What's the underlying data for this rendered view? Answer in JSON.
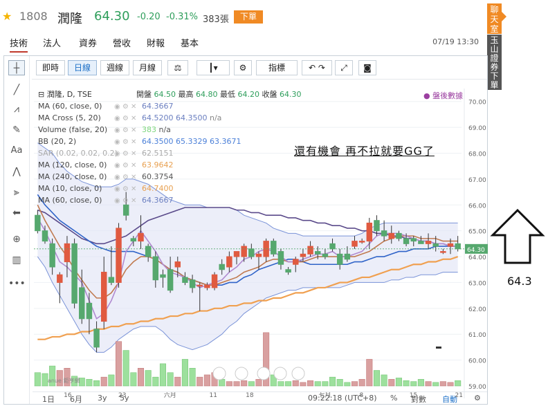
{
  "header": {
    "code": "1808",
    "name": "潤隆",
    "price": "64.30",
    "change": "-0.20",
    "change_pct": "-0.31%",
    "volume": "383張",
    "order_button": "下單"
  },
  "tabs": [
    {
      "label": "技術",
      "active": true
    },
    {
      "label": "法人",
      "active": false
    },
    {
      "label": "資券",
      "active": false
    },
    {
      "label": "營收",
      "active": false
    },
    {
      "label": "財報",
      "active": false
    },
    {
      "label": "基本",
      "active": false
    }
  ],
  "datetime": "07/19 13:30",
  "side": {
    "chatroom": "聊天室",
    "esun": "玉山證券下單"
  },
  "toolbar": {
    "periods": [
      "即時",
      "日線",
      "週線",
      "月線"
    ],
    "selected_period": "日線",
    "indicators_label": "指標"
  },
  "legend": {
    "title": "潤隆, D, TSE",
    "ohlc": {
      "open_label": "開盤",
      "open": "64.50",
      "high_label": "最高",
      "high": "64.80",
      "low_label": "最低",
      "low": "64.20",
      "close_label": "收盤",
      "close": "64.30"
    },
    "after_hours": "盤後數據",
    "studies": [
      {
        "name": "MA (60, close, 0)",
        "values": [
          "64.3667"
        ],
        "colors": [
          "#6b7fc0"
        ]
      },
      {
        "name": "MA Cross (5, 20)",
        "values": [
          "64.5200",
          "64.3500",
          "n/a"
        ],
        "colors": [
          "#6b7fc0",
          "#6b7fc0",
          "#888888"
        ]
      },
      {
        "name": "Volume (false, 20)",
        "values": [
          "383",
          "n/a"
        ],
        "colors": [
          "#7cd67c",
          "#555555"
        ]
      },
      {
        "name": "BB (20, 2)",
        "values": [
          "64.3500",
          "65.3329",
          "63.3671"
        ],
        "colors": [
          "#4a7fd8",
          "#4a7fd8",
          "#4a7fd8"
        ]
      },
      {
        "name": "SAR (0.02, 0.02, 0.2)",
        "values": [
          "62.5151"
        ],
        "colors": [
          "#aaaaaa"
        ]
      },
      {
        "name": "MA (120, close, 0)",
        "values": [
          "63.9642"
        ],
        "colors": [
          "#e8a050"
        ]
      },
      {
        "name": "MA (240, close, 0)",
        "values": [
          "60.3754"
        ],
        "colors": [
          "#555555"
        ]
      },
      {
        "name": "MA (10, close, 0)",
        "values": [
          "64.7400"
        ],
        "colors": [
          "#e8a050"
        ]
      },
      {
        "name": "MA (60, close, 0)",
        "values": [
          "64.3667"
        ],
        "colors": [
          "#6b7fc0"
        ]
      }
    ]
  },
  "price_axis": {
    "ticks": [
      "70.00",
      "69.00",
      "68.00",
      "67.00",
      "66.00",
      "65.00",
      "64.00",
      "63.00",
      "62.00",
      "61.00",
      "60.00",
      "59.00"
    ],
    "current": "64.30"
  },
  "date_axis": [
    "16",
    "23",
    "六月",
    "11",
    "18",
    "七月",
    "8",
    "15",
    "21"
  ],
  "bottombar": {
    "ranges": [
      "1日",
      "6月",
      "3y",
      "5y"
    ],
    "time": "09:22:18 (UTC+8)",
    "pct": "%",
    "log": "對數",
    "auto": "自動"
  },
  "annotation": {
    "text": "還有機會 再不拉就要GG了",
    "arrow_value": "64.3"
  },
  "watermark": "anue 鉅亨網",
  "colors": {
    "up": "#e05a40",
    "down": "#56a86e",
    "accent": "#f08a24"
  },
  "chart_data": {
    "type": "candlestick",
    "ylim": [
      59,
      70.5
    ],
    "candles": [
      {
        "o": 65.6,
        "h": 65.8,
        "l": 64.9,
        "c": 65.0
      },
      {
        "o": 65.0,
        "h": 65.2,
        "l": 64.5,
        "c": 64.6
      },
      {
        "o": 64.5,
        "h": 64.7,
        "l": 63.3,
        "c": 63.6
      },
      {
        "o": 63.0,
        "h": 63.4,
        "l": 62.2,
        "c": 63.3
      },
      {
        "o": 63.8,
        "h": 64.8,
        "l": 63.2,
        "c": 64.5
      },
      {
        "o": 64.5,
        "h": 64.7,
        "l": 62.0,
        "c": 62.2
      },
      {
        "o": 62.8,
        "h": 63.5,
        "l": 61.4,
        "c": 61.6
      },
      {
        "o": 62.2,
        "h": 62.6,
        "l": 61.0,
        "c": 61.6
      },
      {
        "o": 61.2,
        "h": 61.5,
        "l": 60.3,
        "c": 60.5
      },
      {
        "o": 61.5,
        "h": 64.0,
        "l": 61.2,
        "c": 63.4
      },
      {
        "o": 63.2,
        "h": 64.4,
        "l": 62.9,
        "c": 63.0
      },
      {
        "o": 63.0,
        "h": 65.3,
        "l": 62.8,
        "c": 65.1
      },
      {
        "o": 66.0,
        "h": 66.5,
        "l": 65.4,
        "c": 65.6
      },
      {
        "o": 64.7,
        "h": 64.8,
        "l": 64.4,
        "c": 64.6
      },
      {
        "o": 64.6,
        "h": 65.6,
        "l": 64.3,
        "c": 64.9
      },
      {
        "o": 64.4,
        "h": 64.5,
        "l": 63.8,
        "c": 64.0
      },
      {
        "o": 64.0,
        "h": 64.2,
        "l": 62.8,
        "c": 63.1
      },
      {
        "o": 63.3,
        "h": 63.5,
        "l": 62.8,
        "c": 63.2
      },
      {
        "o": 63.5,
        "h": 64.0,
        "l": 62.6,
        "c": 62.7
      },
      {
        "o": 63.6,
        "h": 64.0,
        "l": 63.2,
        "c": 63.8
      },
      {
        "o": 63.2,
        "h": 63.4,
        "l": 62.9,
        "c": 63.0
      },
      {
        "o": 63.1,
        "h": 63.3,
        "l": 62.6,
        "c": 62.8
      },
      {
        "o": 62.9,
        "h": 63.0,
        "l": 61.9,
        "c": 62.9
      },
      {
        "o": 62.8,
        "h": 63.0,
        "l": 62.7,
        "c": 62.9
      },
      {
        "o": 62.8,
        "h": 63.4,
        "l": 62.7,
        "c": 63.3
      },
      {
        "o": 63.7,
        "h": 63.9,
        "l": 63.3,
        "c": 63.5
      },
      {
        "o": 63.6,
        "h": 64.2,
        "l": 63.4,
        "c": 64.0
      },
      {
        "o": 64.0,
        "h": 64.2,
        "l": 63.7,
        "c": 64.2
      },
      {
        "o": 64.0,
        "h": 64.5,
        "l": 63.8,
        "c": 64.4
      },
      {
        "o": 64.3,
        "h": 64.5,
        "l": 63.9,
        "c": 64.0
      },
      {
        "o": 64.0,
        "h": 64.2,
        "l": 63.5,
        "c": 64.1
      },
      {
        "o": 64.0,
        "h": 64.7,
        "l": 63.8,
        "c": 64.6
      },
      {
        "o": 64.6,
        "h": 64.7,
        "l": 64.0,
        "c": 64.1
      },
      {
        "o": 64.2,
        "h": 64.3,
        "l": 63.5,
        "c": 63.7
      },
      {
        "o": 63.5,
        "h": 63.6,
        "l": 63.3,
        "c": 63.4
      },
      {
        "o": 63.7,
        "h": 64.0,
        "l": 63.4,
        "c": 63.9
      },
      {
        "o": 64.0,
        "h": 64.3,
        "l": 63.8,
        "c": 64.1
      },
      {
        "o": 64.1,
        "h": 64.6,
        "l": 64.0,
        "c": 64.4
      },
      {
        "o": 64.2,
        "h": 64.4,
        "l": 63.9,
        "c": 64.1
      },
      {
        "o": 64.1,
        "h": 64.3,
        "l": 63.9,
        "c": 64.0
      },
      {
        "o": 64.5,
        "h": 64.7,
        "l": 64.2,
        "c": 64.3
      },
      {
        "o": 64.1,
        "h": 64.3,
        "l": 63.5,
        "c": 63.7
      },
      {
        "o": 64.1,
        "h": 64.4,
        "l": 63.8,
        "c": 63.9
      },
      {
        "o": 64.4,
        "h": 64.8,
        "l": 64.3,
        "c": 64.6
      },
      {
        "o": 64.6,
        "h": 64.7,
        "l": 64.5,
        "c": 64.6
      },
      {
        "o": 64.6,
        "h": 65.5,
        "l": 64.3,
        "c": 65.3
      },
      {
        "o": 65.4,
        "h": 65.6,
        "l": 64.8,
        "c": 65.0
      },
      {
        "o": 65.0,
        "h": 65.4,
        "l": 64.6,
        "c": 64.8
      },
      {
        "o": 64.7,
        "h": 65.2,
        "l": 64.5,
        "c": 64.9
      },
      {
        "o": 64.9,
        "h": 65.0,
        "l": 64.6,
        "c": 64.7
      },
      {
        "o": 64.7,
        "h": 64.9,
        "l": 64.4,
        "c": 64.5
      },
      {
        "o": 64.7,
        "h": 64.8,
        "l": 64.4,
        "c": 64.6
      },
      {
        "o": 64.6,
        "h": 64.8,
        "l": 64.5,
        "c": 64.5
      },
      {
        "o": 64.5,
        "h": 64.9,
        "l": 64.3,
        "c": 64.6
      },
      {
        "o": 64.5,
        "h": 64.8,
        "l": 64.2,
        "c": 64.4
      },
      {
        "o": 64.2,
        "h": 64.3,
        "l": 64.1,
        "c": 64.2
      },
      {
        "o": 64.4,
        "h": 64.7,
        "l": 64.1,
        "c": 64.5
      },
      {
        "o": 64.5,
        "h": 64.8,
        "l": 64.2,
        "c": 64.3
      }
    ],
    "volume": [
      0.3,
      0.28,
      0.45,
      0.35,
      0.4,
      0.22,
      0.18,
      0.15,
      0.12,
      0.2,
      0.25,
      1.0,
      0.8,
      0.3,
      0.4,
      0.35,
      0.2,
      0.5,
      0.3,
      0.2,
      0.6,
      0.4,
      0.2,
      0.25,
      0.3,
      0.15,
      0.1,
      0.1,
      0.12,
      0.1,
      0.15,
      1.2,
      0.25,
      0.1,
      0.1,
      0.12,
      0.08,
      0.12,
      0.1,
      0.1,
      0.2,
      0.15,
      0.08,
      0.1,
      0.15,
      0.6,
      0.35,
      0.25,
      0.15,
      0.18,
      0.12,
      0.1,
      0.15,
      0.1,
      0.08,
      0.1,
      0.08,
      0.12
    ],
    "volume_ylim": [
      0,
      1.4
    ],
    "ma_lines": [
      {
        "name": "MA (60, close, 0)",
        "color": "#5a4a8a",
        "values": [
          65.8,
          65.7,
          65.5,
          65.3,
          65.1,
          64.9,
          64.7,
          64.6,
          64.5,
          64.5,
          64.6,
          64.7,
          64.8,
          65.0,
          65.2,
          65.4,
          65.5,
          65.6,
          65.7,
          65.8,
          65.9,
          65.9,
          65.9,
          65.9,
          65.9,
          65.9,
          65.9,
          65.8,
          65.8,
          65.7,
          65.7,
          65.6,
          65.6,
          65.6,
          65.5,
          65.5,
          65.4,
          65.4,
          65.3,
          65.3,
          65.2,
          65.2,
          65.1,
          65.1,
          65.0,
          65.0,
          64.9,
          64.9,
          64.8,
          64.8,
          64.7,
          64.7,
          64.6,
          64.6,
          64.5,
          64.5,
          64.4,
          64.4
        ]
      },
      {
        "name": "MA (20, close, 0)",
        "color": "#2f63c8",
        "values": [
          66.4,
          66.0,
          65.7,
          65.4,
          65.2,
          65.0,
          64.8,
          64.6,
          64.4,
          64.3,
          64.2,
          64.2,
          64.2,
          64.2,
          64.1,
          64.0,
          63.9,
          63.7,
          63.5,
          63.4,
          63.2,
          63.1,
          63.0,
          62.9,
          62.9,
          62.9,
          63.0,
          63.0,
          63.2,
          63.3,
          63.5,
          63.6,
          63.7,
          63.8,
          63.9,
          63.9,
          63.8,
          63.7,
          63.7,
          63.7,
          63.7,
          63.7,
          63.7,
          63.8,
          63.8,
          63.9,
          64.0,
          64.0,
          64.1,
          64.2,
          64.2,
          64.3,
          64.3,
          64.3,
          64.4,
          64.4,
          64.4,
          64.4
        ]
      },
      {
        "name": "MA (120, close, 0)",
        "color": "#f0a050",
        "values": [
          60.8,
          60.8,
          60.9,
          60.9,
          61.0,
          61.0,
          61.1,
          61.1,
          61.2,
          61.2,
          61.3,
          61.3,
          61.4,
          61.4,
          61.5,
          61.5,
          61.6,
          61.6,
          61.7,
          61.7,
          61.8,
          61.8,
          61.9,
          61.9,
          62.0,
          62.0,
          62.1,
          62.1,
          62.2,
          62.2,
          62.3,
          62.3,
          62.4,
          62.4,
          62.5,
          62.6,
          62.6,
          62.7,
          62.8,
          62.8,
          62.9,
          63.0,
          63.0,
          63.1,
          63.2,
          63.2,
          63.3,
          63.4,
          63.5,
          63.5,
          63.6,
          63.7,
          63.7,
          63.8,
          63.8,
          63.9,
          63.9,
          64.0
        ]
      },
      {
        "name": "MA (10, close, 0)",
        "color": "#c07a50",
        "values": [
          66.0,
          65.4,
          64.9,
          64.4,
          64.0,
          63.5,
          63.1,
          62.7,
          62.4,
          62.4,
          62.6,
          63.0,
          63.5,
          63.8,
          64.0,
          64.0,
          63.9,
          63.7,
          63.5,
          63.4,
          63.2,
          63.1,
          63.0,
          62.9,
          62.9,
          63.0,
          63.1,
          63.2,
          63.4,
          63.5,
          63.6,
          63.8,
          63.9,
          63.9,
          63.8,
          63.8,
          63.8,
          63.9,
          64.0,
          64.0,
          64.0,
          64.0,
          64.0,
          64.0,
          64.1,
          64.2,
          64.4,
          64.6,
          64.7,
          64.8,
          64.8,
          64.8,
          64.7,
          64.7,
          64.7,
          64.6,
          64.6,
          64.6
        ]
      },
      {
        "name": "MA (5, close, 0)",
        "color": "#b08ad0",
        "values": [
          65.5,
          65.0,
          64.4,
          63.8,
          63.6,
          63.3,
          63.0,
          62.3,
          61.6,
          61.8,
          62.3,
          63.0,
          64.2,
          64.6,
          65.0,
          64.6,
          64.2,
          63.7,
          63.4,
          63.3,
          63.2,
          63.0,
          62.8,
          62.9,
          63.0,
          63.1,
          63.4,
          63.6,
          63.9,
          64.0,
          64.2,
          64.3,
          64.2,
          64.0,
          63.8,
          63.8,
          63.9,
          64.0,
          64.1,
          64.1,
          64.2,
          64.0,
          64.0,
          64.1,
          64.2,
          64.5,
          64.8,
          64.9,
          64.9,
          64.9,
          64.8,
          64.7,
          64.6,
          64.6,
          64.5,
          64.5,
          64.4,
          64.4
        ]
      }
    ],
    "bollinger": {
      "upper": [
        68.4,
        68.2,
        68.0,
        67.6,
        67.3,
        67.1,
        66.9,
        66.8,
        66.7,
        66.7,
        66.7,
        66.8,
        67.0,
        67.0,
        66.9,
        66.8,
        66.6,
        66.4,
        66.2,
        66.1,
        66.0,
        66.0,
        66.0,
        65.9,
        65.9,
        65.9,
        65.9,
        65.8,
        65.6,
        65.5,
        65.4,
        65.3,
        65.1,
        65.0,
        64.9,
        64.9,
        64.8,
        64.8,
        64.8,
        64.8,
        64.8,
        64.8,
        64.8,
        64.8,
        64.9,
        65.1,
        65.2,
        65.3,
        65.3,
        65.3,
        65.3,
        65.3,
        65.3,
        65.3,
        65.3,
        65.3,
        65.3,
        65.3
      ],
      "lower": [
        64.0,
        63.6,
        63.0,
        62.5,
        62.0,
        61.5,
        61.0,
        60.6,
        60.3,
        60.3,
        60.5,
        60.8,
        61.0,
        61.2,
        61.3,
        61.3,
        61.3,
        61.1,
        60.8,
        60.6,
        60.5,
        60.4,
        60.5,
        60.6,
        60.8,
        61.0,
        61.3,
        61.5,
        61.8,
        62.0,
        62.2,
        62.4,
        62.5,
        62.6,
        62.7,
        62.7,
        62.8,
        62.8,
        62.8,
        62.8,
        62.8,
        62.8,
        62.9,
        63.0,
        63.0,
        63.0,
        63.0,
        63.0,
        63.1,
        63.1,
        63.2,
        63.2,
        63.3,
        63.3,
        63.3,
        63.4,
        63.4,
        63.4
      ]
    }
  }
}
